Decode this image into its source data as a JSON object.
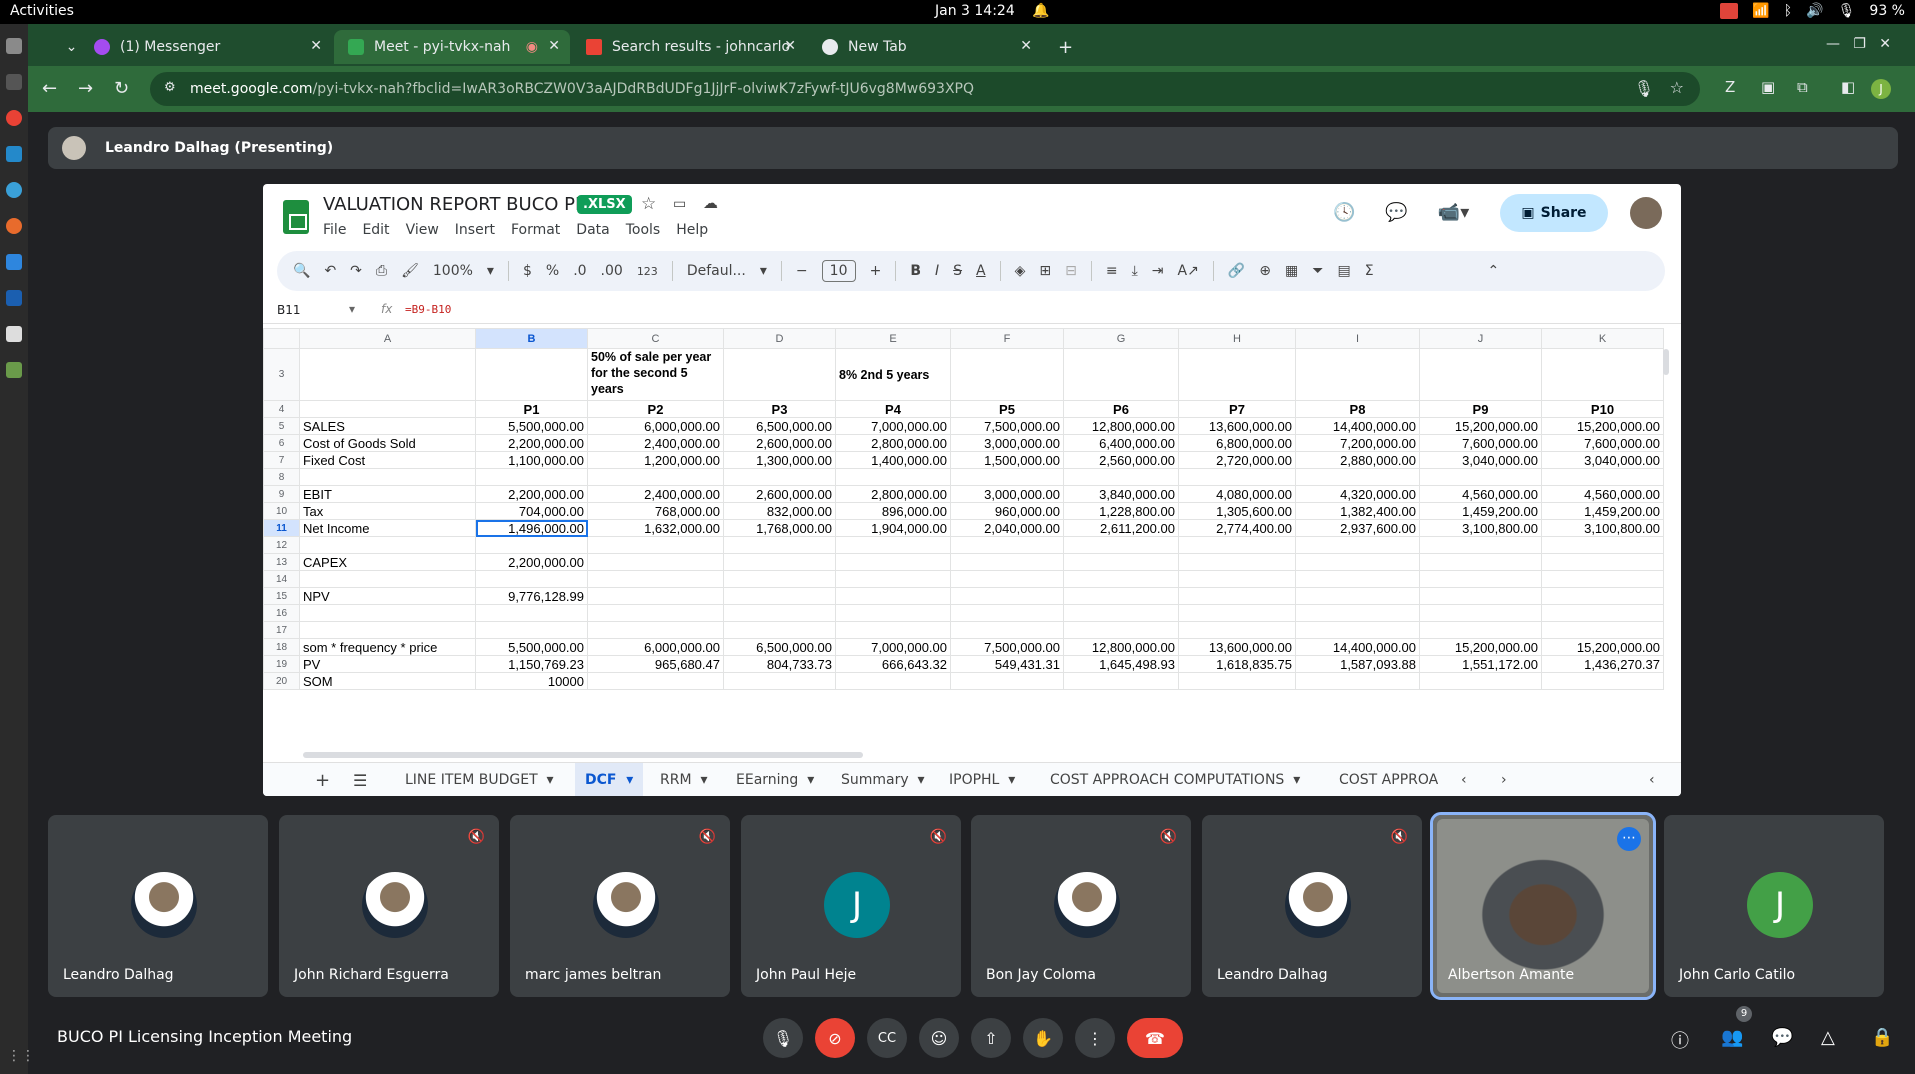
{
  "topbar": {
    "activities": "Activities",
    "clock": "Jan 3  14:24",
    "battery": "93 %"
  },
  "browser": {
    "tabs": [
      {
        "title": "(1) Messenger",
        "icon": "messenger-icon"
      },
      {
        "title": "Meet - pyi-tvkx-nah",
        "icon": "meet-icon"
      },
      {
        "title": "Search results - johncarlo",
        "icon": "gmail-icon"
      },
      {
        "title": "New Tab",
        "icon": "chrome-icon"
      }
    ],
    "url_host": "meet.google.com",
    "url_path": "/pyi-tvkx-nah?fbclid=IwAR3oRBCZW0V3aAJDdRBdUDFg1JjJrF-olviwK7zFywf-tJU6vg8Mw693XPQ",
    "profile_letter": "J"
  },
  "presenter": {
    "label": "Leandro Dalhag (Presenting)"
  },
  "sheet": {
    "title": "VALUATION REPORT BUCO PI",
    "badge": ".XLSX",
    "menu": [
      "File",
      "Edit",
      "View",
      "Insert",
      "Format",
      "Data",
      "Tools",
      "Help"
    ],
    "share": "Share",
    "zoom": "100%",
    "font": "Defaul...",
    "font_size": "10",
    "cell_ref": "B11",
    "formula": "=B9-B10",
    "columns": [
      "A",
      "B",
      "C",
      "D",
      "E",
      "F",
      "G",
      "H",
      "I",
      "J",
      "K"
    ],
    "rows": [
      {
        "n": "3",
        "cells": [
          "",
          "",
          "50% of sale per year for the second 5 years",
          "",
          "8% 2nd 5 years",
          "",
          "",
          "",
          "",
          "",
          ""
        ]
      },
      {
        "n": "4",
        "cells": [
          "",
          "P1",
          "P2",
          "P3",
          "P4",
          "P5",
          "P6",
          "P7",
          "P8",
          "P9",
          "P10"
        ]
      },
      {
        "n": "5",
        "cells": [
          "SALES",
          "5,500,000.00",
          "6,000,000.00",
          "6,500,000.00",
          "7,000,000.00",
          "7,500,000.00",
          "12,800,000.00",
          "13,600,000.00",
          "14,400,000.00",
          "15,200,000.00",
          "15,200,000.00"
        ]
      },
      {
        "n": "6",
        "cells": [
          "Cost of Goods Sold",
          "2,200,000.00",
          "2,400,000.00",
          "2,600,000.00",
          "2,800,000.00",
          "3,000,000.00",
          "6,400,000.00",
          "6,800,000.00",
          "7,200,000.00",
          "7,600,000.00",
          "7,600,000.00"
        ]
      },
      {
        "n": "7",
        "cells": [
          "Fixed Cost",
          "1,100,000.00",
          "1,200,000.00",
          "1,300,000.00",
          "1,400,000.00",
          "1,500,000.00",
          "2,560,000.00",
          "2,720,000.00",
          "2,880,000.00",
          "3,040,000.00",
          "3,040,000.00"
        ]
      },
      {
        "n": "8",
        "cells": [
          "",
          "",
          "",
          "",
          "",
          "",
          "",
          "",
          "",
          "",
          ""
        ]
      },
      {
        "n": "9",
        "cells": [
          "EBIT",
          "2,200,000.00",
          "2,400,000.00",
          "2,600,000.00",
          "2,800,000.00",
          "3,000,000.00",
          "3,840,000.00",
          "4,080,000.00",
          "4,320,000.00",
          "4,560,000.00",
          "4,560,000.00"
        ]
      },
      {
        "n": "10",
        "cells": [
          "Tax",
          "704,000.00",
          "768,000.00",
          "832,000.00",
          "896,000.00",
          "960,000.00",
          "1,228,800.00",
          "1,305,600.00",
          "1,382,400.00",
          "1,459,200.00",
          "1,459,200.00"
        ]
      },
      {
        "n": "11",
        "cells": [
          "Net Income",
          "1,496,000.00",
          "1,632,000.00",
          "1,768,000.00",
          "1,904,000.00",
          "2,040,000.00",
          "2,611,200.00",
          "2,774,400.00",
          "2,937,600.00",
          "3,100,800.00",
          "3,100,800.00"
        ]
      },
      {
        "n": "12",
        "cells": [
          "",
          "",
          "",
          "",
          "",
          "",
          "",
          "",
          "",
          "",
          ""
        ]
      },
      {
        "n": "13",
        "cells": [
          "CAPEX",
          "2,200,000.00",
          "",
          "",
          "",
          "",
          "",
          "",
          "",
          "",
          ""
        ]
      },
      {
        "n": "14",
        "cells": [
          "",
          "",
          "",
          "",
          "",
          "",
          "",
          "",
          "",
          "",
          ""
        ]
      },
      {
        "n": "15",
        "cells": [
          "NPV",
          "9,776,128.99",
          "",
          "",
          "",
          "",
          "",
          "",
          "",
          "",
          ""
        ]
      },
      {
        "n": "16",
        "cells": [
          "",
          "",
          "",
          "",
          "",
          "",
          "",
          "",
          "",
          "",
          ""
        ]
      },
      {
        "n": "17",
        "cells": [
          "",
          "",
          "",
          "",
          "",
          "",
          "",
          "",
          "",
          "",
          ""
        ]
      },
      {
        "n": "18",
        "cells": [
          "som * frequency * price",
          "5,500,000.00",
          "6,000,000.00",
          "6,500,000.00",
          "7,000,000.00",
          "7,500,000.00",
          "12,800,000.00",
          "13,600,000.00",
          "14,400,000.00",
          "15,200,000.00",
          "15,200,000.00"
        ]
      },
      {
        "n": "19",
        "cells": [
          "PV",
          "1,150,769.23",
          "965,680.47",
          "804,733.73",
          "666,643.32",
          "549,431.31",
          "1,645,498.93",
          "1,618,835.75",
          "1,587,093.88",
          "1,551,172.00",
          "1,436,270.37"
        ]
      },
      {
        "n": "20",
        "cells": [
          "SOM",
          "10000",
          "",
          "",
          "",
          "",
          "",
          "",
          "",
          "",
          ""
        ]
      }
    ],
    "sheet_tabs": [
      "LINE ITEM BUDGET",
      "DCF",
      "RRM",
      "EEarning",
      "Summary",
      "IPOPHL",
      "COST APPROACH COMPUTATIONS",
      "COST APPROA"
    ]
  },
  "participants": [
    {
      "name": "Leandro Dalhag",
      "avatar": "photo",
      "muted": false
    },
    {
      "name": "John Richard Esguerra",
      "avatar": "photo",
      "muted": true
    },
    {
      "name": "marc james beltran",
      "avatar": "photo",
      "muted": true
    },
    {
      "name": "John Paul Heje",
      "avatar": "J",
      "muted": true,
      "color": "#00838f"
    },
    {
      "name": "Bon Jay Coloma",
      "avatar": "photo",
      "muted": true
    },
    {
      "name": "Leandro Dalhag",
      "avatar": "photo",
      "muted": true
    },
    {
      "name": "Albertson Amante",
      "avatar": "video",
      "muted": false
    },
    {
      "name": "John Carlo Catilo",
      "avatar": "J",
      "muted": false,
      "color": "#43a047"
    }
  ],
  "meeting": {
    "title": "BUCO PI Licensing Inception Meeting",
    "people_count": "9"
  }
}
